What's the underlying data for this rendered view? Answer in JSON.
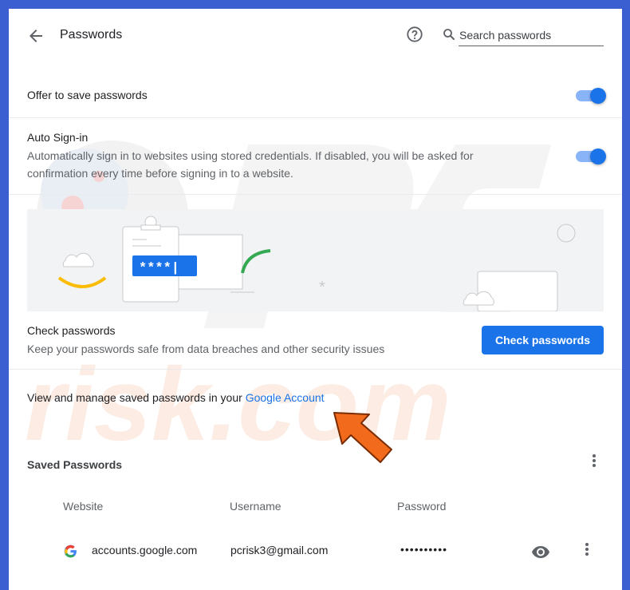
{
  "header": {
    "title": "Passwords",
    "search_placeholder": "Search passwords"
  },
  "offer_to_save": {
    "label": "Offer to save passwords",
    "enabled": true
  },
  "auto_signin": {
    "label": "Auto Sign-in",
    "description_line1": "Automatically sign in to websites using stored credentials. If disabled, you will be asked for",
    "description_line2": "confirmation every time before signing in to a website.",
    "enabled": true
  },
  "banner": {
    "password_mask": "****|"
  },
  "check_passwords": {
    "title": "Check passwords",
    "description": "Keep your passwords safe from data breaches and other security issues",
    "button_label": "Check passwords"
  },
  "google_account": {
    "text": "View and manage saved passwords in your",
    "link_label": "Google Account"
  },
  "saved_passwords": {
    "title": "Saved Passwords",
    "columns": [
      "Website",
      "Username",
      "Password"
    ],
    "rows": [
      {
        "website": "accounts.google.com",
        "username": "pcrisk3@gmail.com",
        "password": "••••••••••"
      }
    ]
  },
  "colors": {
    "accent": "#1a73e8",
    "toggle_track": "#8ab4f8",
    "annotation_arrow": "#f26b1d",
    "frame": "#3b5fd0"
  }
}
